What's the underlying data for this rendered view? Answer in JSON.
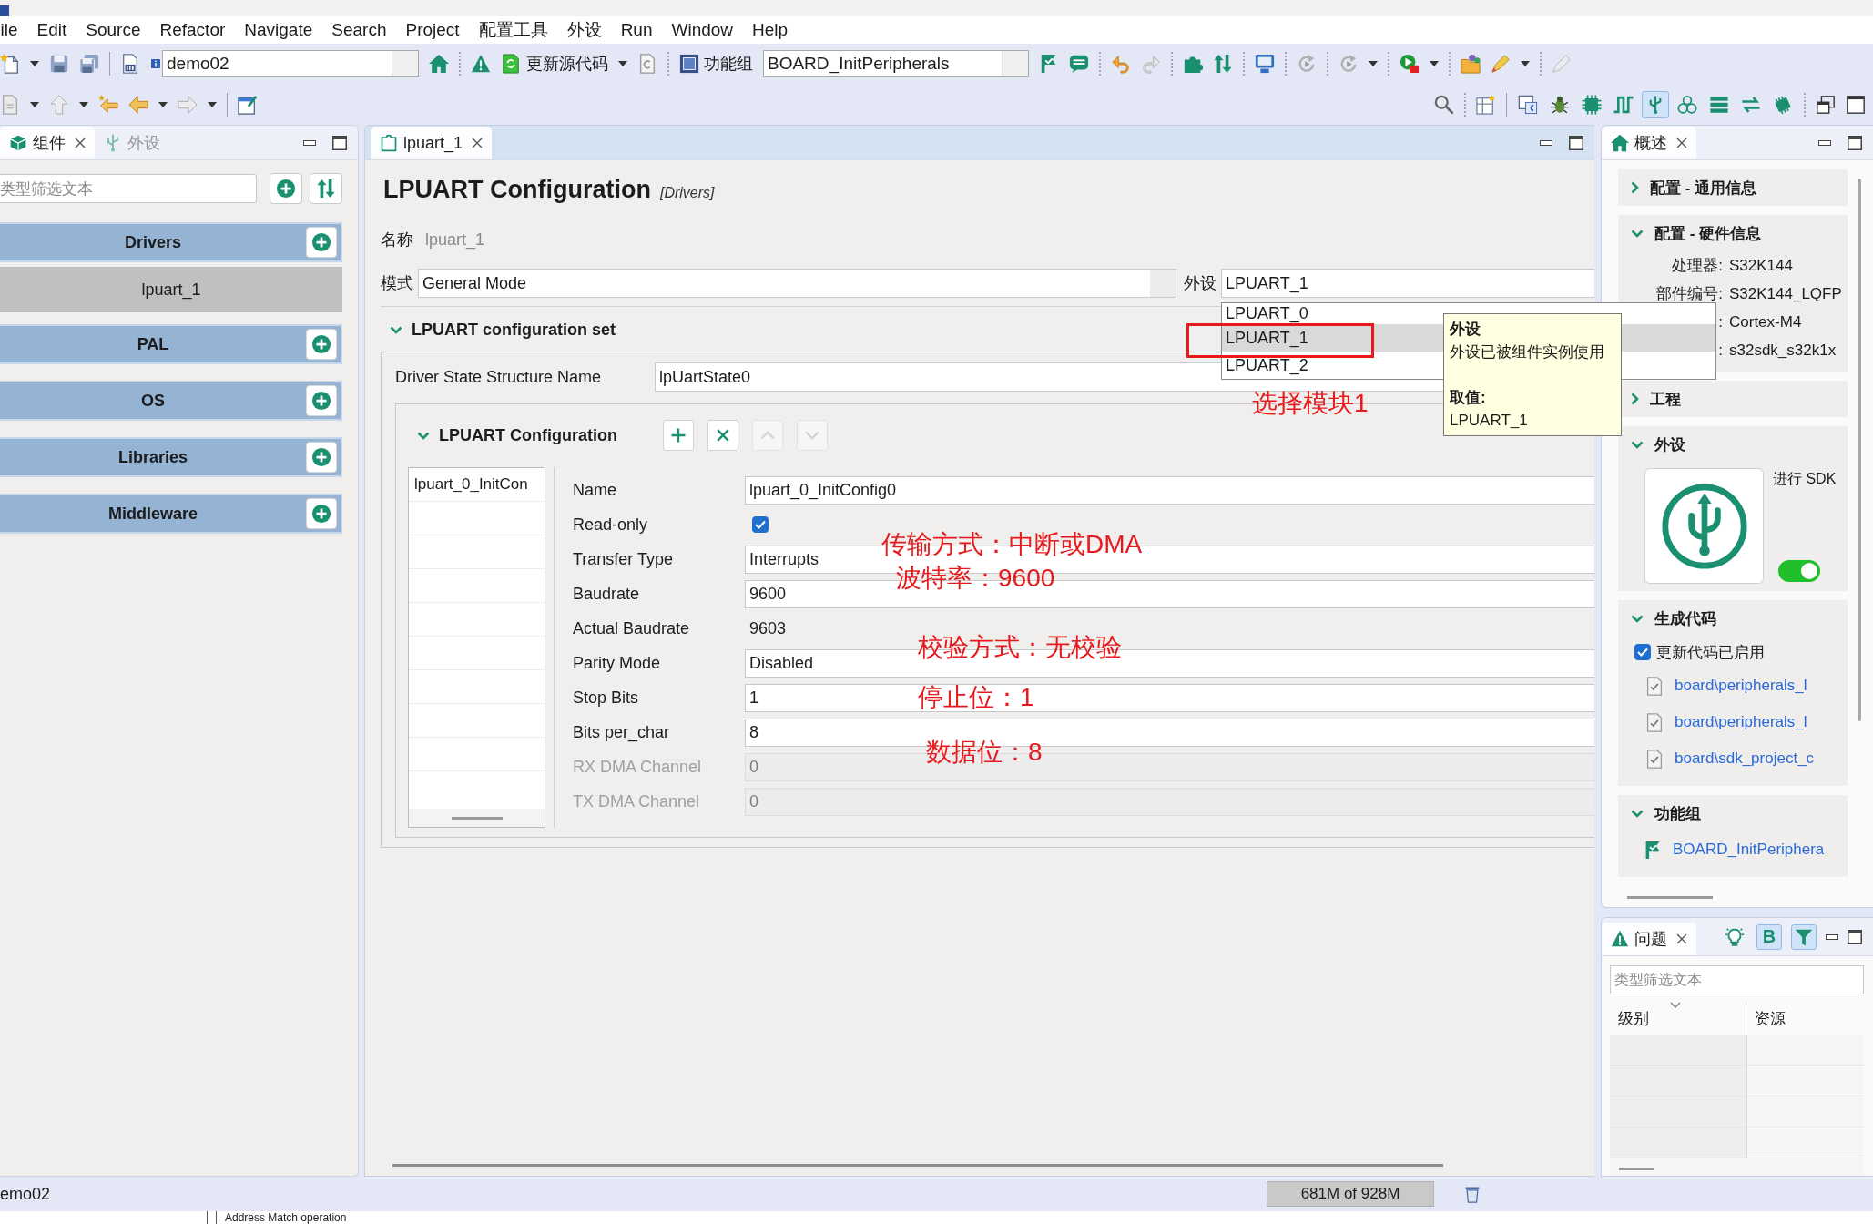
{
  "menu_bar": {
    "items": [
      "ile",
      "Edit",
      "Source",
      "Refactor",
      "Navigate",
      "Search",
      "Project",
      "配置工具",
      "外设",
      "Run",
      "Window",
      "Help"
    ]
  },
  "toolbar": {
    "project": {
      "value": "demo02"
    },
    "update_code": {
      "label": "更新源代码"
    },
    "function_group": {
      "label": "功能组",
      "value": "BOARD_InitPeripherals"
    }
  },
  "perspective_bar": [
    {
      "selected": false
    },
    {
      "selected": false
    },
    {
      "selected": false
    },
    {
      "selected": false
    },
    {
      "selected": true
    },
    {
      "selected": false
    },
    {
      "selected": false
    },
    {
      "selected": false
    },
    {
      "selected": false
    }
  ],
  "components_panel": {
    "tabs": [
      {
        "label": "组件",
        "selected": true
      },
      {
        "label": "外设",
        "selected": false
      }
    ],
    "filter": {
      "placeholder": "类型筛选文本"
    },
    "categories": [
      {
        "label": "Drivers",
        "items": [
          {
            "label": "lpuart_1",
            "selected": true
          }
        ]
      },
      {
        "label": "PAL"
      },
      {
        "label": "OS"
      },
      {
        "label": "Libraries"
      },
      {
        "label": "Middleware"
      }
    ]
  },
  "editor": {
    "tabs": [
      {
        "label": "lpuart_1",
        "selected": true
      }
    ],
    "title": "LPUART Configuration",
    "subtitle": "[Drivers]",
    "name": {
      "label": "名称",
      "value": "lpuart_1",
      "disabled": true
    },
    "mode": {
      "label": "模式",
      "value": "General Mode"
    },
    "peripheral": {
      "label": "外设",
      "value": "LPUART_1"
    },
    "config_set": {
      "title": "LPUART configuration set",
      "expanded": true,
      "state_structure": {
        "label": "Driver State Structure Name",
        "value": "lpUartState0"
      },
      "configuration": {
        "title": "LPUART Configuration",
        "expanded": true,
        "actions": [
          {
            "kind": "add",
            "disabled": false
          },
          {
            "kind": "remove",
            "disabled": false
          },
          {
            "kind": "up",
            "disabled": true
          },
          {
            "kind": "down",
            "disabled": true
          }
        ],
        "instances": [
          {
            "label": "lpuart_0_InitCon"
          }
        ],
        "properties": [
          {
            "kind": "field",
            "label": "Name",
            "value": "lpuart_0_InitConfig0",
            "disabled": false
          },
          {
            "kind": "checkbox",
            "label": "Read-only",
            "checked": true
          },
          {
            "kind": "field",
            "label": "Transfer Type",
            "value": "Interrupts",
            "disabled": false
          },
          {
            "kind": "field",
            "label": "Baudrate",
            "value": "9600",
            "disabled": false
          },
          {
            "kind": "text",
            "label": "Actual Baudrate",
            "value": "9603"
          },
          {
            "kind": "field",
            "label": "Parity Mode",
            "value": "Disabled",
            "disabled": false
          },
          {
            "kind": "field",
            "label": "Stop Bits",
            "value": "1",
            "disabled": false
          },
          {
            "kind": "field",
            "label": "Bits per_char",
            "value": "8",
            "disabled": false
          },
          {
            "kind": "field",
            "label": "RX DMA Channel",
            "value": "0",
            "disabled": true
          },
          {
            "kind": "field",
            "label": "TX DMA Channel",
            "value": "0",
            "disabled": true
          }
        ]
      }
    }
  },
  "peripheral_dropdown": {
    "options": [
      {
        "label": "LPUART_0",
        "selected": false
      },
      {
        "label": "LPUART_1",
        "selected": true
      },
      {
        "label": "LPUART_2",
        "selected": false
      }
    ]
  },
  "tooltip": {
    "title": "外设",
    "text": "外设已被组件实例使用",
    "value_title": "取值:",
    "value": "LPUART_1"
  },
  "annotations": [
    {
      "kind": "box"
    },
    {
      "kind": "note",
      "text": "选择模块1"
    },
    {
      "kind": "note",
      "text": "传输方式：中断或DMA"
    },
    {
      "kind": "note",
      "text": "波特率：9600"
    },
    {
      "kind": "note",
      "text": "校验方式：无校验"
    },
    {
      "kind": "note",
      "text": "停止位：1"
    },
    {
      "kind": "note",
      "text": "数据位：8"
    }
  ],
  "overview_panel": {
    "tab": {
      "label": "概述"
    },
    "sections": [
      {
        "title": "配置 - 通用信息",
        "expanded": false
      },
      {
        "kind": "info",
        "title": "配置 - 硬件信息",
        "expanded": true,
        "rows": [
          {
            "label": "处理器:",
            "value": "S32K144"
          },
          {
            "label": "部件编号:",
            "value": "S32K144_LQFP"
          },
          {
            "label": ":",
            "value": "Cortex-M4"
          },
          {
            "label": ":",
            "value": "s32sdk_s32k1x"
          }
        ]
      },
      {
        "title": "工程",
        "expanded": false
      },
      {
        "kind": "peripheral",
        "title": "外设",
        "expanded": true,
        "caption": "进行 SDK",
        "enabled": true
      },
      {
        "kind": "codegen",
        "title": "生成代码",
        "expanded": true,
        "option": {
          "label": "更新代码已启用",
          "checked": true
        },
        "files": [
          {
            "label": "board\\peripherals_l"
          },
          {
            "label": "board\\peripherals_l"
          },
          {
            "label": "board\\sdk_project_c"
          }
        ]
      },
      {
        "kind": "groups",
        "title": "功能组",
        "expanded": true,
        "items": [
          {
            "label": "BOARD_InitPeriphera"
          }
        ]
      }
    ]
  },
  "problems_panel": {
    "tab": {
      "label": "问题"
    },
    "toolbar": [
      {
        "kind": "bulb",
        "on": false
      },
      {
        "kind": "text",
        "label": "B",
        "on": true
      },
      {
        "kind": "filter",
        "on": true
      }
    ],
    "filter": {
      "placeholder": "类型筛选文本"
    },
    "columns": [
      {
        "label": "级别",
        "sorted": true
      },
      {
        "label": "资源",
        "sorted": false
      }
    ]
  },
  "status_bar": {
    "text": "emo02",
    "heap": "681M of 928M"
  },
  "background_window": {
    "text": "Address Match operation"
  }
}
